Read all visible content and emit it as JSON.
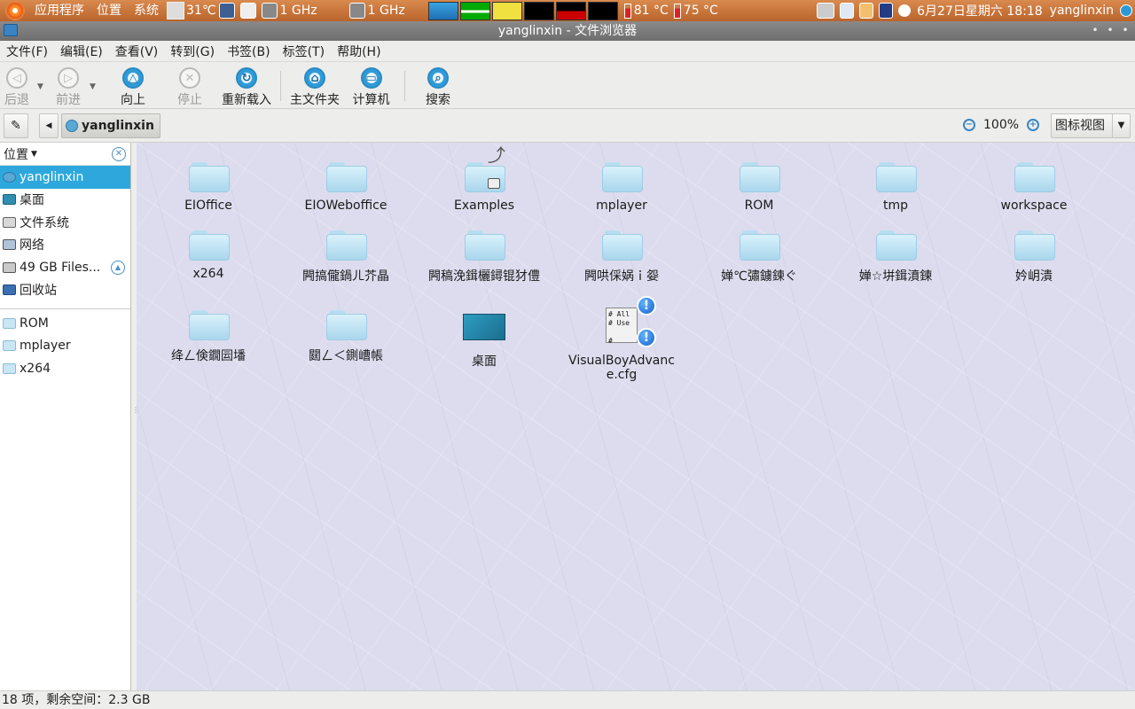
{
  "top_panel": {
    "menus": [
      "应用程序",
      "位置",
      "系统"
    ],
    "temp1": "31℃",
    "cpu1": "1 GHz",
    "cpu2": "1 GHz",
    "temp_sensor1": "81 °C",
    "temp_sensor2": "75 °C",
    "datetime": "6月27日星期六 18:18",
    "user": "yanglinxin"
  },
  "window": {
    "title": "yanglinxin - 文件浏览器"
  },
  "menubar": [
    "文件(F)",
    "编辑(E)",
    "查看(V)",
    "转到(G)",
    "书签(B)",
    "标签(T)",
    "帮助(H)"
  ],
  "toolbar": {
    "back": "后退",
    "forward": "前进",
    "up": "向上",
    "stop": "停止",
    "reload": "重新载入",
    "home": "主文件夹",
    "computer": "计算机",
    "search": "搜索"
  },
  "location": {
    "crumb": "yanglinxin",
    "zoom": "100%",
    "view": "图标视图"
  },
  "sidebar": {
    "header": "位置",
    "places": [
      {
        "label": "yanglinxin",
        "icon": "home-icon",
        "selected": true
      },
      {
        "label": "桌面",
        "icon": "desktop-icon"
      },
      {
        "label": "文件系统",
        "icon": "filesystem-icon"
      },
      {
        "label": "网络",
        "icon": "network-icon"
      },
      {
        "label": "49 GB Files...",
        "icon": "drive-icon"
      },
      {
        "label": "回收站",
        "icon": "trash-icon"
      }
    ],
    "bookmarks": [
      "ROM",
      "mplayer",
      "x264"
    ]
  },
  "files": [
    {
      "name": "EIOffice",
      "type": "folder"
    },
    {
      "name": "EIOWeboffice",
      "type": "folder"
    },
    {
      "name": "Examples",
      "type": "folder-link-locked"
    },
    {
      "name": "mplayer",
      "type": "folder"
    },
    {
      "name": "ROM",
      "type": "folder"
    },
    {
      "name": "tmp",
      "type": "folder"
    },
    {
      "name": "workspace",
      "type": "folder"
    },
    {
      "name": "x264",
      "type": "folder"
    },
    {
      "name": "闁搞儱鍋ㄦ芥晶",
      "type": "folder"
    },
    {
      "name": "闁稿浼鍓欐鐞锟犲僼",
      "type": "folder"
    },
    {
      "name": "闁哄倸娲ｉ妴",
      "type": "folder"
    },
    {
      "name": "婵℃彇鐪鍊ぐ",
      "type": "folder"
    },
    {
      "name": "婵☆垪鍓濆鍊",
      "type": "folder"
    },
    {
      "name": "妗岄潰",
      "type": "folder"
    },
    {
      "name": "绛ㄥ倹鐗囩墦",
      "type": "folder"
    },
    {
      "name": "閮ㄥ＜鍘嶆帳",
      "type": "folder"
    },
    {
      "name": "桌面",
      "type": "desktop-file"
    },
    {
      "name": "VisualBoyAdvance.cfg",
      "type": "config-file"
    }
  ],
  "statusbar": {
    "text": "18 项，剩余空间：2.3 GB"
  }
}
